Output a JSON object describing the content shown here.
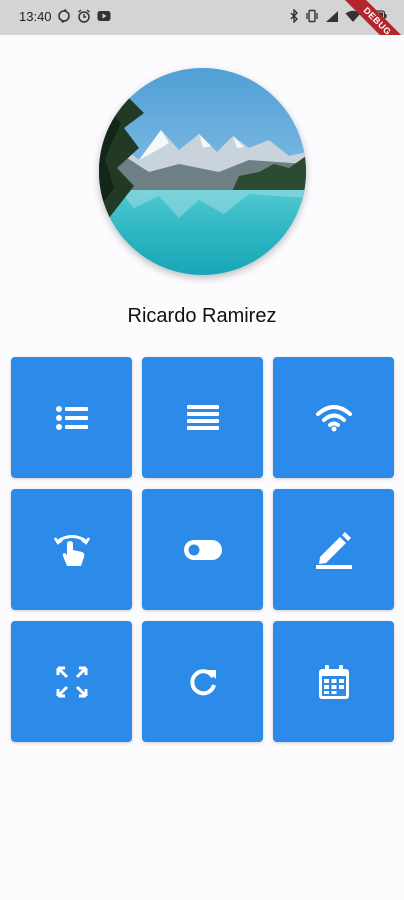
{
  "status_bar": {
    "time": "13:40",
    "icons": [
      "sync-icon",
      "alarm-icon",
      "youtube-icon",
      "bluetooth-icon",
      "vibrate-icon",
      "signal-icon",
      "wifi-icon",
      "battery-icon"
    ]
  },
  "debug_banner": "DEBUG",
  "profile": {
    "name": "Ricardo Ramirez"
  },
  "tiles": [
    {
      "icon": "list-icon"
    },
    {
      "icon": "lines-icon"
    },
    {
      "icon": "wifi-icon"
    },
    {
      "icon": "swipe-gesture-icon"
    },
    {
      "icon": "toggle-icon"
    },
    {
      "icon": "edit-icon"
    },
    {
      "icon": "fullscreen-icon"
    },
    {
      "icon": "refresh-icon"
    },
    {
      "icon": "calendar-icon"
    }
  ],
  "colors": {
    "tile": "#2c8be9",
    "background": "#fcfbfe",
    "status_bar": "#d4d4d4",
    "debug_ribbon": "#b3262b"
  }
}
